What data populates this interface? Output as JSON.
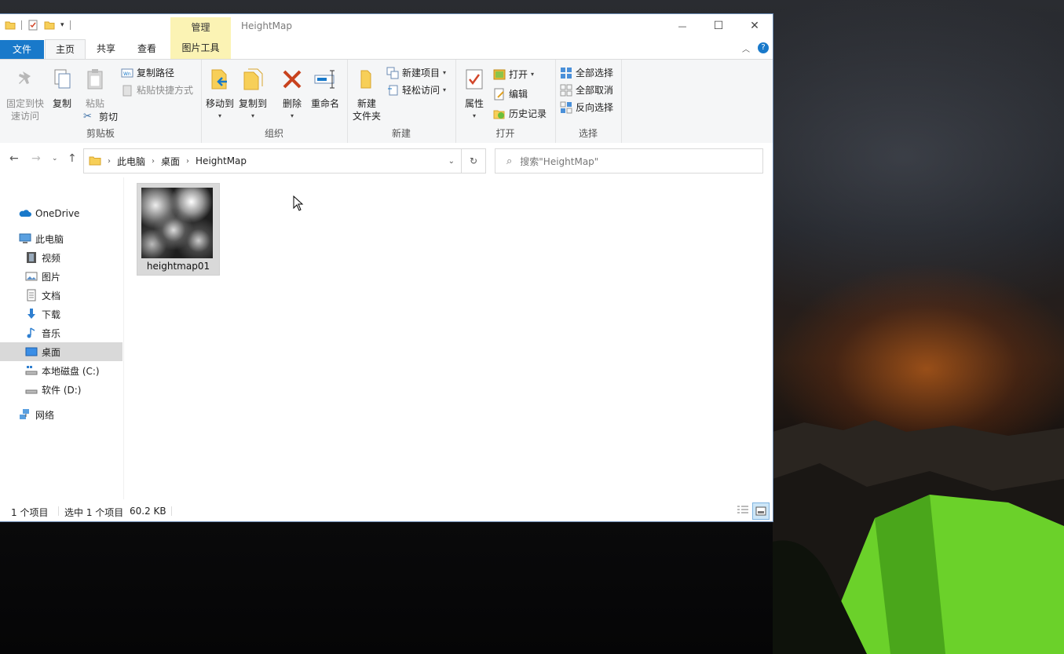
{
  "window": {
    "title": "HeightMap",
    "manage_tab": "管理",
    "controls": {
      "minimize": "—",
      "maximize": "☐",
      "close": "✕"
    }
  },
  "tabs": {
    "file": "文件",
    "home": "主页",
    "share": "共享",
    "view": "查看",
    "picture_tools": "图片工具"
  },
  "ribbon": {
    "clipboard": {
      "pin_line1": "固定到快",
      "pin_line2": "速访问",
      "copy": "复制",
      "paste": "粘贴",
      "copy_path": "复制路径",
      "paste_shortcut": "粘贴快捷方式",
      "cut": "剪切",
      "label": "剪贴板"
    },
    "organize": {
      "move_to": "移动到",
      "copy_to": "复制到",
      "delete": "删除",
      "rename": "重命名",
      "label": "组织"
    },
    "new": {
      "new_folder_line1": "新建",
      "new_folder_line2": "文件夹",
      "new_item": "新建项目",
      "easy_access": "轻松访问",
      "label": "新建"
    },
    "open": {
      "properties": "属性",
      "open": "打开",
      "edit": "编辑",
      "history": "历史记录",
      "label": "打开"
    },
    "select": {
      "select_all": "全部选择",
      "select_none": "全部取消",
      "invert": "反向选择",
      "label": "选择"
    }
  },
  "address": {
    "crumbs": [
      "此电脑",
      "桌面",
      "HeightMap"
    ],
    "search_placeholder": "搜索\"HeightMap\""
  },
  "nav": {
    "onedrive": "OneDrive",
    "this_pc": "此电脑",
    "videos": "视频",
    "pictures": "图片",
    "documents": "文档",
    "downloads": "下载",
    "music": "音乐",
    "desktop": "桌面",
    "local_disk": "本地磁盘 (C:)",
    "software": "软件 (D:)",
    "network": "网络"
  },
  "files": [
    {
      "name": "heightmap01"
    }
  ],
  "status": {
    "count": "1 个项目",
    "selected": "选中 1 个项目",
    "size": "60.2 KB"
  },
  "colors": {
    "accent": "#1979ca",
    "picture_tools_tab": "#fbf3b4",
    "selection": "#d9d9d9"
  }
}
